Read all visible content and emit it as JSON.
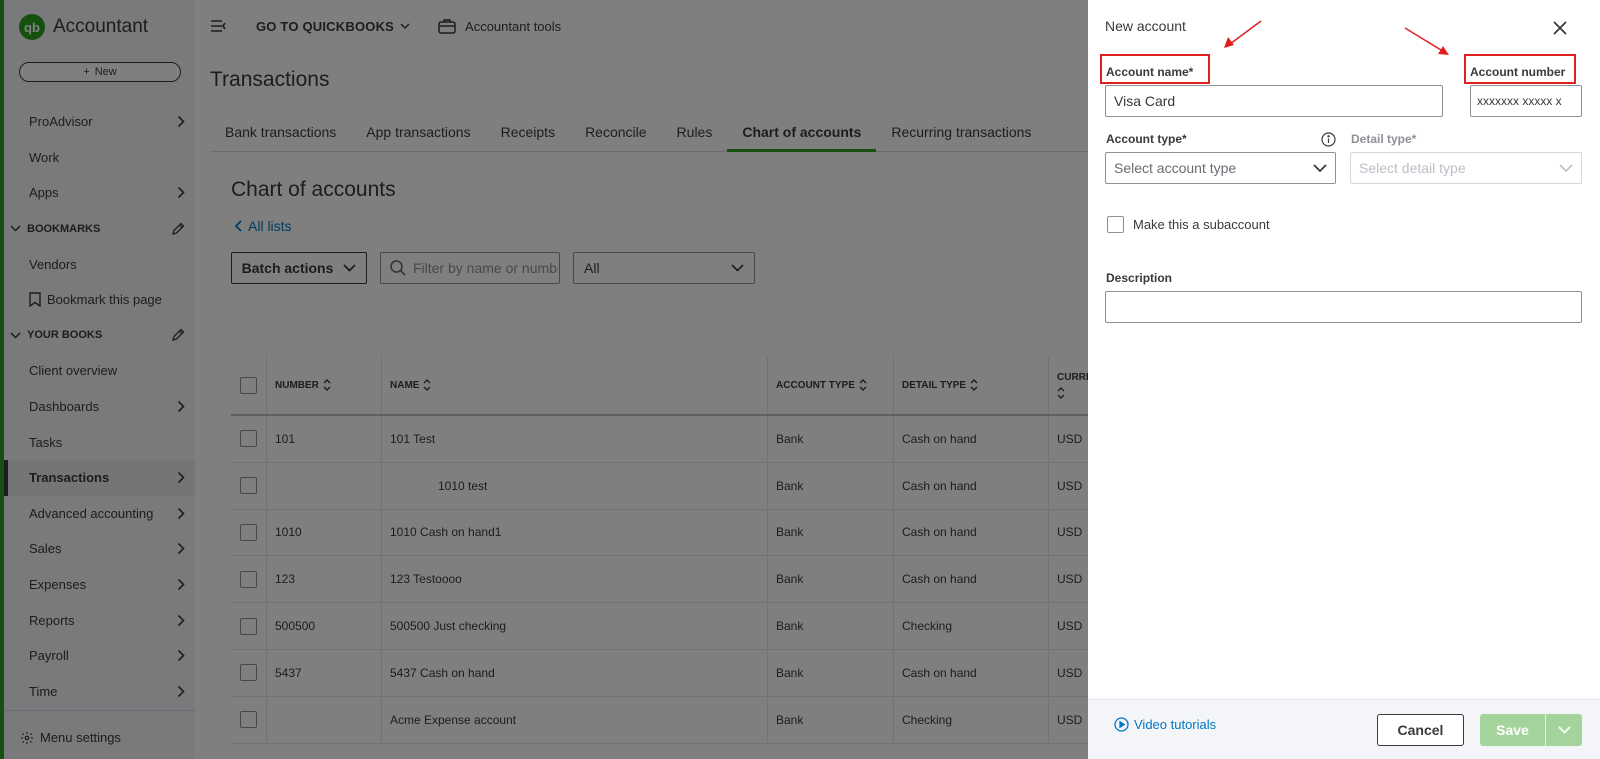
{
  "app": {
    "logo_letters": "qb",
    "name": "Accountant",
    "new_label": "New"
  },
  "sidebar": {
    "items": [
      {
        "label": "ProAdvisor",
        "chevron": true
      },
      {
        "label": "Work",
        "chevron": false
      },
      {
        "label": "Apps",
        "chevron": true
      },
      {
        "label": "BOOKMARKS",
        "section": true
      },
      {
        "label": "Vendors",
        "chevron": false
      },
      {
        "label": "Bookmark this page",
        "bookmark": true
      },
      {
        "label": "YOUR BOOKS",
        "section": true
      },
      {
        "label": "Client overview",
        "chevron": false
      },
      {
        "label": "Dashboards",
        "chevron": true
      },
      {
        "label": "Tasks",
        "chevron": false
      },
      {
        "label": "Transactions",
        "chevron": true,
        "active": true
      },
      {
        "label": "Advanced accounting",
        "chevron": true
      },
      {
        "label": "Sales",
        "chevron": true
      },
      {
        "label": "Expenses",
        "chevron": true
      },
      {
        "label": "Reports",
        "chevron": true
      },
      {
        "label": "Payroll",
        "chevron": true
      },
      {
        "label": "Time",
        "chevron": true
      }
    ],
    "menu_settings": "Menu settings"
  },
  "topbar": {
    "goto": "GO TO QUICKBOOKS",
    "tools": "Accountant tools"
  },
  "page": {
    "title": "Transactions",
    "tabs": [
      "Bank transactions",
      "App transactions",
      "Receipts",
      "Reconcile",
      "Rules",
      "Chart of accounts",
      "Recurring transactions"
    ],
    "active_tab": "Chart of accounts",
    "heading": "Chart of accounts",
    "all_lists": "All lists",
    "batch_actions": "Batch actions",
    "filter_placeholder": "Filter by name or number",
    "filter_select": "All"
  },
  "table": {
    "headers": {
      "number": "NUMBER",
      "name": "NAME",
      "type": "ACCOUNT TYPE",
      "detail": "DETAIL TYPE",
      "currency": "CURRE"
    },
    "rows": [
      {
        "number": "101",
        "name": "101 Test",
        "type": "Bank",
        "detail": "Cash on hand",
        "currency": "USD",
        "sub": false
      },
      {
        "number": "",
        "name": "1010 test",
        "type": "Bank",
        "detail": "Cash on hand",
        "currency": "USD",
        "sub": true
      },
      {
        "number": "1010",
        "name": "1010 Cash on hand1",
        "type": "Bank",
        "detail": "Cash on hand",
        "currency": "USD",
        "sub": false
      },
      {
        "number": "123",
        "name": "123 Testoooo",
        "type": "Bank",
        "detail": "Cash on hand",
        "currency": "USD",
        "sub": false
      },
      {
        "number": "500500",
        "name": "500500 Just checking",
        "type": "Bank",
        "detail": "Checking",
        "currency": "USD",
        "sub": false
      },
      {
        "number": "5437",
        "name": "5437 Cash on hand",
        "type": "Bank",
        "detail": "Cash on hand",
        "currency": "USD",
        "sub": false
      },
      {
        "number": "",
        "name": "Acme Expense account",
        "type": "Bank",
        "detail": "Checking",
        "currency": "USD",
        "sub": false
      }
    ]
  },
  "panel": {
    "title": "New account",
    "account_name_label": "Account name*",
    "account_name_value": "Visa Card",
    "account_number_label": "Account number",
    "account_number_value": "xxxxxxx xxxxx x",
    "account_type_label": "Account type*",
    "account_type_placeholder": "Select account type",
    "detail_type_label": "Detail type*",
    "detail_type_placeholder": "Select detail type",
    "subaccount_label": "Make this a subaccount",
    "description_label": "Description",
    "description_value": "",
    "video_tutorials": "Video tutorials",
    "cancel": "Cancel",
    "save": "Save"
  },
  "colors": {
    "brand_green": "#2ca01c",
    "link_blue": "#0077c5",
    "annotation_red": "#e02020",
    "save_disabled": "#a4d49b"
  }
}
